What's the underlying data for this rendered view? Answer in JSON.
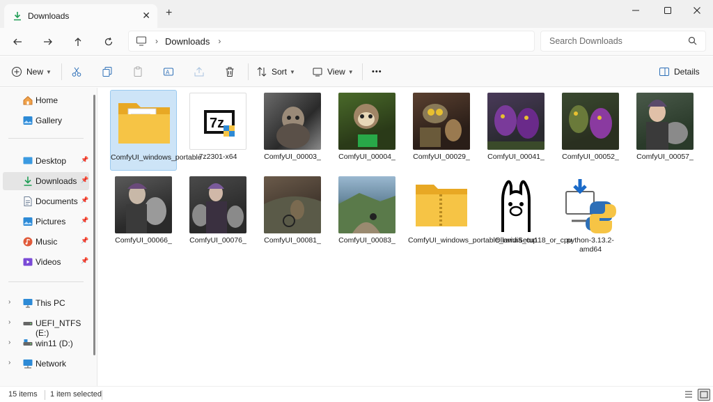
{
  "tab": {
    "title": "Downloads",
    "close": "✕",
    "new_tab": "+"
  },
  "window_controls": {
    "minimize": "—",
    "maximize": "☐",
    "close": "✕"
  },
  "nav": {
    "back": "←",
    "forward": "→",
    "up": "↑",
    "refresh": "↻",
    "breadcrumb": "Downloads",
    "search_placeholder": "Search Downloads"
  },
  "toolbar": {
    "new_label": "New",
    "sort_label": "Sort",
    "view_label": "View",
    "more_label": "•••",
    "details_label": "Details"
  },
  "sidebar": {
    "quick": [
      {
        "label": "Home",
        "icon": "home-icon"
      },
      {
        "label": "Gallery",
        "icon": "gallery-icon"
      }
    ],
    "pinned": [
      {
        "label": "Desktop",
        "icon": "desktop-icon",
        "color": "#3b9ae1"
      },
      {
        "label": "Downloads",
        "icon": "download-icon",
        "color": "#1f9d55"
      },
      {
        "label": "Documents",
        "icon": "documents-icon",
        "color": "#6b7c93"
      },
      {
        "label": "Pictures",
        "icon": "pictures-icon",
        "color": "#2d8ad6"
      },
      {
        "label": "Music",
        "icon": "music-icon",
        "color": "#e05a3a"
      },
      {
        "label": "Videos",
        "icon": "videos-icon",
        "color": "#7a4ad6"
      }
    ],
    "drives": [
      {
        "label": "This PC",
        "icon": "computer-icon"
      },
      {
        "label": "UEFI_NTFS (E:)",
        "icon": "drive-icon"
      },
      {
        "label": "win11 (D:)",
        "icon": "drive-icon"
      },
      {
        "label": "Network",
        "icon": "network-icon"
      }
    ]
  },
  "files": [
    {
      "name": "ComfyUI_windows_portable",
      "type": "folder"
    },
    {
      "name": "7z2301-x64",
      "type": "7z"
    },
    {
      "name": "ComfyUI_00003_",
      "type": "image"
    },
    {
      "name": "ComfyUI_00004_",
      "type": "image"
    },
    {
      "name": "ComfyUI_00029_",
      "type": "image"
    },
    {
      "name": "ComfyUI_00041_",
      "type": "image"
    },
    {
      "name": "ComfyUI_00052_",
      "type": "image"
    },
    {
      "name": "ComfyUI_00057_",
      "type": "image"
    },
    {
      "name": "ComfyUI_00066_",
      "type": "image"
    },
    {
      "name": "ComfyUI_00076_",
      "type": "image"
    },
    {
      "name": "ComfyUI_00081_",
      "type": "image"
    },
    {
      "name": "ComfyUI_00083_",
      "type": "image"
    },
    {
      "name": "ComfyUI_windows_portable_nvidia_cu118_or_cpu",
      "type": "zip"
    },
    {
      "name": "OllamaSetup",
      "type": "ollama"
    },
    {
      "name": "python-3.13.2-amd64",
      "type": "python"
    }
  ],
  "status": {
    "count": "15 items",
    "selection": "1 item selected"
  },
  "colors": {
    "accent": "#0067c0",
    "selection": "#cde4f7",
    "folder": "#f6c445"
  }
}
